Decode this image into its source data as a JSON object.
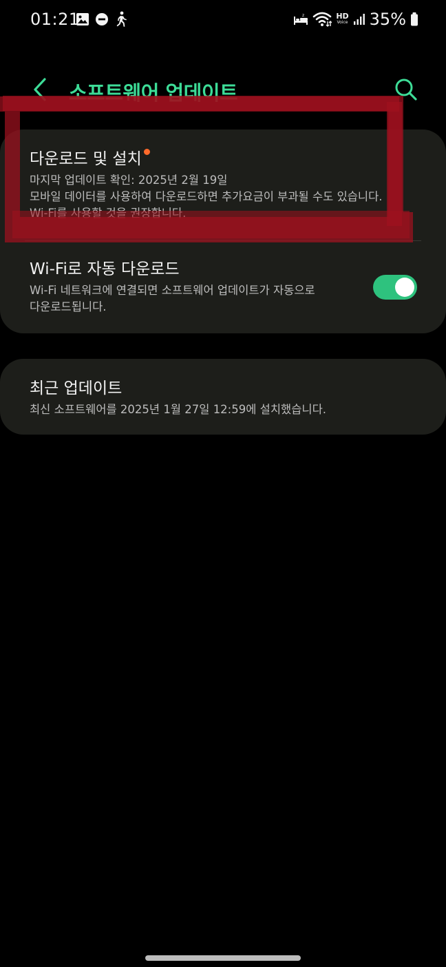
{
  "status_bar": {
    "time": "01:21",
    "left_icons": [
      "gallery-icon",
      "do-not-disturb-icon",
      "walking-icon"
    ],
    "right_icons": [
      "sleep-mode-icon",
      "wifi-icon",
      "hd-voice-icon",
      "signal-icon",
      "battery-icon"
    ],
    "hd_label": "HD",
    "voice_label": "Voice",
    "battery": "35%"
  },
  "header": {
    "title": "소프트웨어 업데이트",
    "back_icon": "back-arrow-icon",
    "search_icon": "search-icon"
  },
  "colors": {
    "accent": "#3ddc97",
    "toggle_on": "#2ec27e",
    "badge_dot": "#ff6a2b",
    "card_bg": "#1d1e1a",
    "annotation": "#a0101e"
  },
  "download_card": {
    "title": "다운로드 및 설치",
    "has_new_badge": true,
    "desc_line1": "마지막 업데이트 확인: 2025년 2월 19일",
    "desc_line2": "모바일 데이터를 사용하여 다운로드하면 추가요금이 부과될 수도 있습니다.",
    "desc_line3": "Wi-Fi를 사용할 것을 권장합니다."
  },
  "auto_download": {
    "title": "Wi-Fi로 자동 다운로드",
    "desc_line1": "Wi-Fi 네트워크에 연결되면 소프트웨어 업데이트가 자동으로",
    "desc_line2": "다운로드됩니다.",
    "enabled": true
  },
  "recent_update": {
    "title": "최근 업데이트",
    "desc": "최신 소프트웨어를 2025년 1월 27일 12:59에 설치했습니다."
  }
}
